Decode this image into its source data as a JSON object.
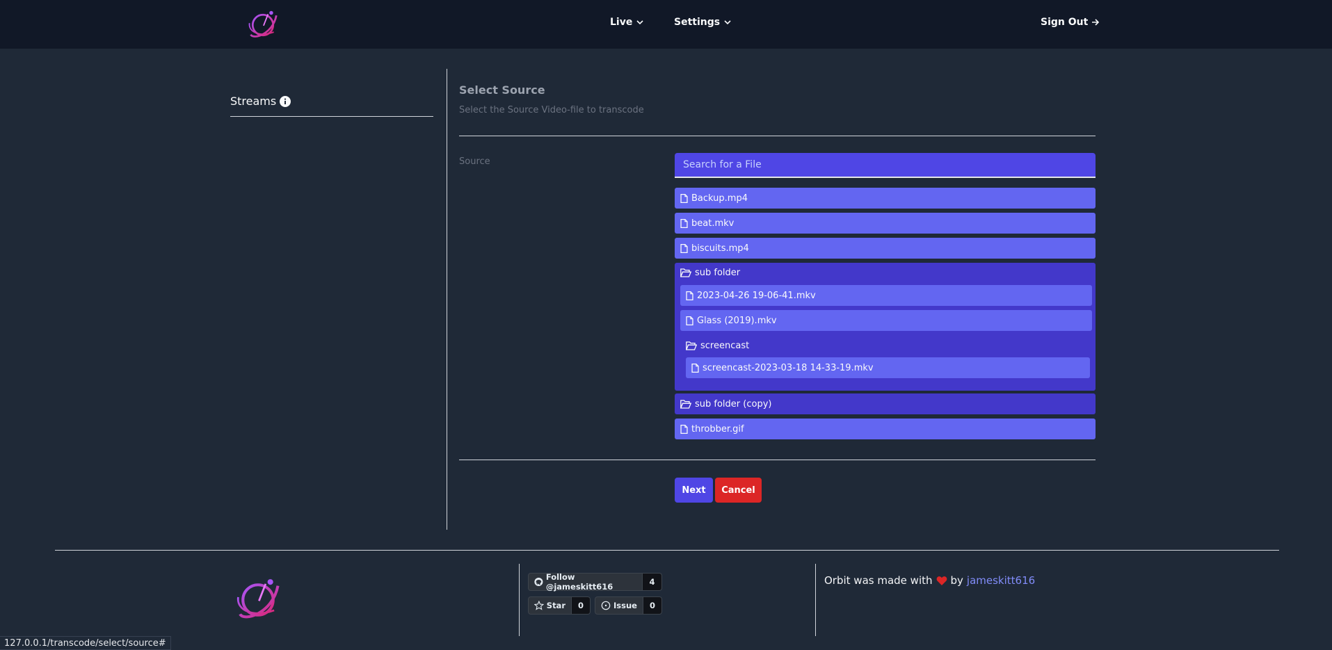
{
  "nav": {
    "live": "Live",
    "settings": "Settings",
    "sign_out": "Sign Out",
    "logo_icon": "orbit-logo"
  },
  "sidebar": {
    "title": "Streams",
    "info_icon": "info-circle-icon"
  },
  "main": {
    "title": "Select Source",
    "description": "Select the Source Video-file to transcode",
    "source_label": "Source",
    "search_placeholder": "Search for a File",
    "files": {
      "f1": "Backup.mp4",
      "f2": "beat.mkv",
      "f3": "biscuits.mp4",
      "folder1": "sub folder",
      "folder1_f1": "2023-04-26 19-06-41.mkv",
      "folder1_f2": "Glass (2019).mkv",
      "folder1_sub": "screencast",
      "folder1_sub_f1": "screencast-2023-03-18 14-33-19.mkv",
      "folder2": "sub folder (copy)",
      "f4": "throbber.gif"
    },
    "next": "Next",
    "cancel": "Cancel"
  },
  "footer": {
    "follow": "Follow @jameskitt616",
    "follow_count": "4",
    "star": "Star",
    "star_count": "0",
    "issue": "Issue",
    "issue_count": "0",
    "credit_pre": "Orbit was made with",
    "credit_by": "by",
    "credit_author": "jameskitt616"
  },
  "status_bar": "127.0.0.1/transcode/select/source#",
  "colors": {
    "background": "#1f2937",
    "navbar": "#111827",
    "primary": "#4f46e5",
    "file_row": "#6366f1",
    "folder": "#4338ca",
    "cancel": "#dc2626",
    "link": "#818cf8"
  }
}
